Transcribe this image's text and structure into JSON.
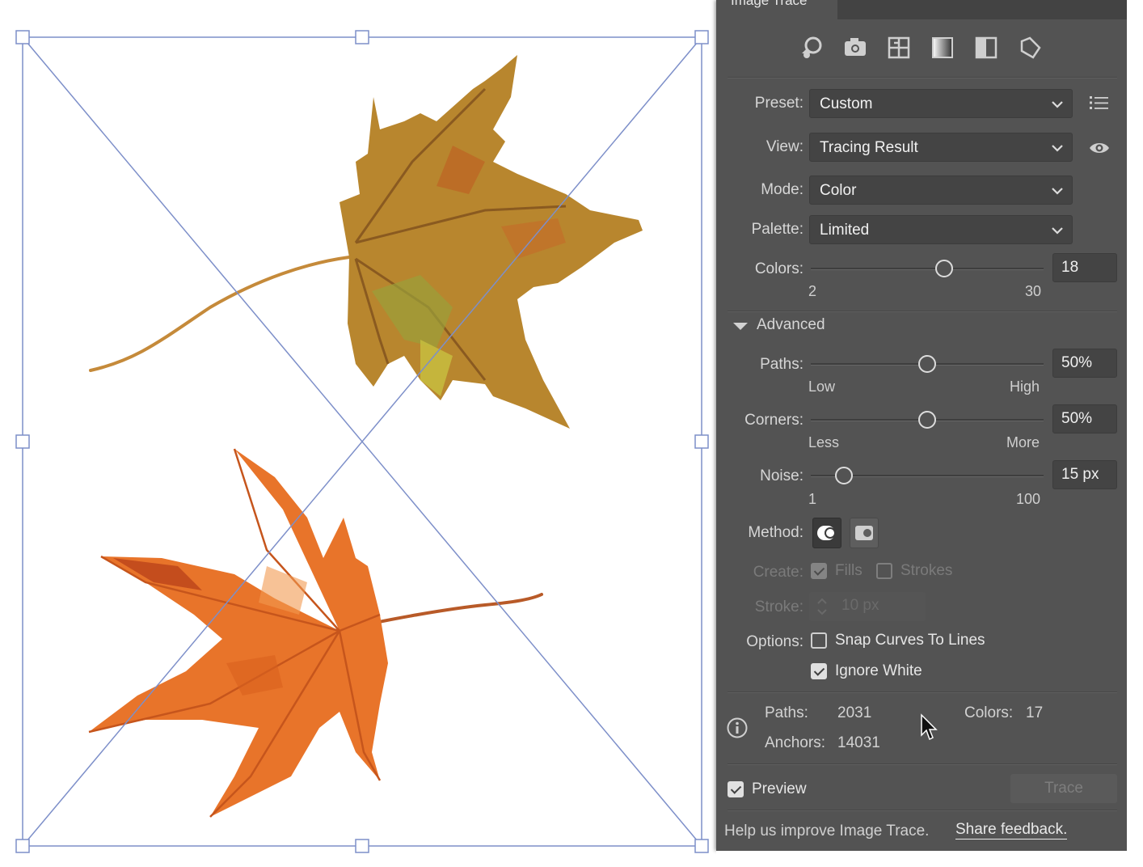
{
  "panel": {
    "title": "Image Trace",
    "icons": [
      "auto-color-preset-icon",
      "high-fidelity-photo-icon",
      "low-fidelity-photo-icon",
      "grayscale-icon",
      "black-and-white-icon",
      "outline-icon"
    ],
    "preset": {
      "label": "Preset:",
      "value": "Custom"
    },
    "view": {
      "label": "View:",
      "value": "Tracing Result"
    },
    "mode": {
      "label": "Mode:",
      "value": "Color"
    },
    "palette": {
      "label": "Palette:",
      "value": "Limited"
    },
    "colors": {
      "label": "Colors:",
      "value": "18",
      "min": "2",
      "max": "30",
      "level": 18
    },
    "advanced_label": "Advanced",
    "paths": {
      "label": "Paths:",
      "value": "50%",
      "min": "Low",
      "max": "High",
      "level": 0.5
    },
    "corners": {
      "label": "Corners:",
      "value": "50%",
      "min": "Less",
      "max": "More",
      "level": 0.5
    },
    "noise": {
      "label": "Noise:",
      "value": "15 px",
      "min": "1",
      "max": "100",
      "level": 15
    },
    "method_label": "Method:",
    "create": {
      "label": "Create:",
      "fills": "Fills",
      "strokes": "Strokes",
      "fills_checked": true,
      "strokes_checked": false
    },
    "stroke": {
      "label": "Stroke:",
      "value": "10 px"
    },
    "options": {
      "label": "Options:",
      "snap": "Snap Curves To Lines",
      "snap_checked": false,
      "ignore_white": "Ignore White",
      "ignore_white_checked": true
    },
    "info": {
      "paths_label": "Paths:",
      "paths_value": "2031",
      "colors_label": "Colors:",
      "colors_value": "17",
      "anchors_label": "Anchors:",
      "anchors_value": "14031"
    },
    "preview_label": "Preview",
    "preview_checked": true,
    "trace_button": "Trace",
    "feedback_text": "Help us improve Image Trace.",
    "feedback_link": "Share feedback."
  },
  "colors": {
    "panel_bg": "#535353",
    "field_bg": "#444444",
    "bounding_box": "#7d8fc9",
    "leaf_top": "#b8862e",
    "leaf_bottom": "#e8742a"
  }
}
